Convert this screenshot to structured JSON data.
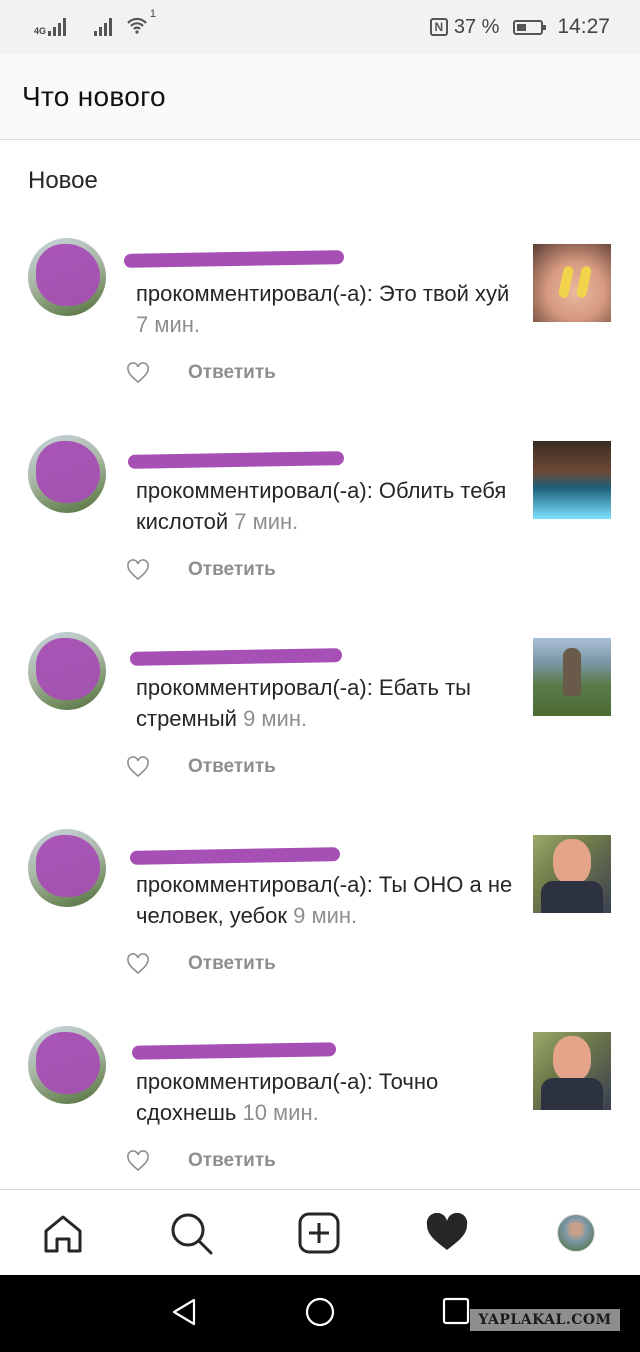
{
  "status_bar": {
    "network_1": "4G",
    "network_2": "4G",
    "wifi_badge": "1",
    "nfc": "N",
    "battery": "37 %",
    "time": "14:27"
  },
  "header": {
    "title": "Что нового"
  },
  "section": {
    "title": "Новое"
  },
  "reply_label": "Ответить",
  "items": [
    {
      "text": "прокомментировал(-а): Это твой хуй",
      "time": "7 мин."
    },
    {
      "text": "прокомментировал(-а): Облить тебя кислотой",
      "time": "7 мин."
    },
    {
      "text": "прокомментировал(-а): Ебать ты стремный",
      "time": "9 мин."
    },
    {
      "text": "прокомментировал(-а): Ты ОНО а не человек, уебок",
      "time": "9 мин."
    },
    {
      "text": "прокомментировал(-а): Точно сдохнешь",
      "time": "10 мин."
    }
  ],
  "tabs": [
    "home-icon",
    "search-icon",
    "new-post-icon",
    "activity-heart-icon",
    "profile-avatar"
  ],
  "watermark": "YAPLAKAL.COM",
  "colors": {
    "redaction": "#a64fb4",
    "muted": "#8e8e8e",
    "text": "#262626"
  }
}
